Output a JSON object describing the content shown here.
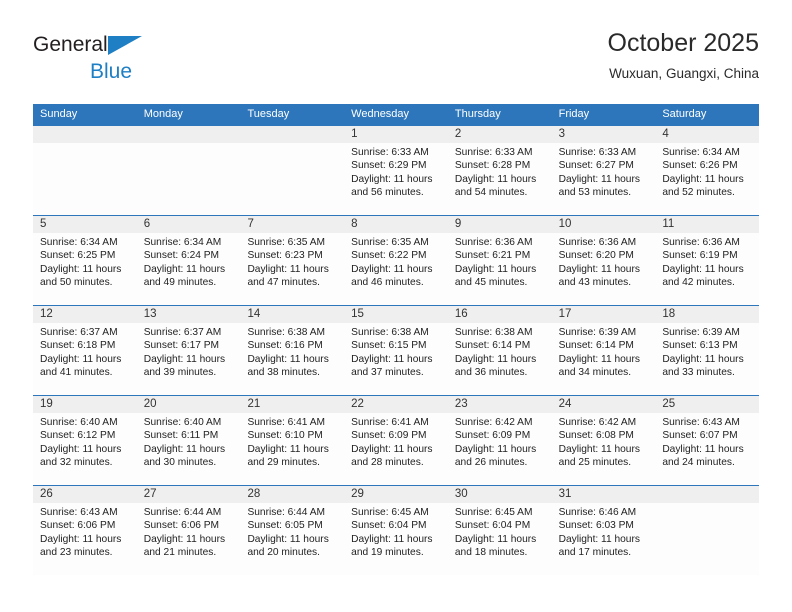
{
  "brand": {
    "name_top": "General",
    "name_bottom": "Blue",
    "triangle_color": "#1f7fc4",
    "top_text_color": "#231f20"
  },
  "header": {
    "title": "October 2025",
    "subtitle": "Wuxuan, Guangxi, China"
  },
  "theme": {
    "header_blue": "#2d76bb",
    "daynum_bar": "#efefef",
    "cell_bg": "#fdfdfd",
    "text": "#222222"
  },
  "weekdays": [
    "Sunday",
    "Monday",
    "Tuesday",
    "Wednesday",
    "Thursday",
    "Friday",
    "Saturday"
  ],
  "weeks": [
    [
      {
        "day": "",
        "sunrise": "",
        "sunset": "",
        "daylight1": "",
        "daylight2": ""
      },
      {
        "day": "",
        "sunrise": "",
        "sunset": "",
        "daylight1": "",
        "daylight2": ""
      },
      {
        "day": "",
        "sunrise": "",
        "sunset": "",
        "daylight1": "",
        "daylight2": ""
      },
      {
        "day": "1",
        "sunrise": "Sunrise: 6:33 AM",
        "sunset": "Sunset: 6:29 PM",
        "daylight1": "Daylight: 11 hours",
        "daylight2": "and 56 minutes."
      },
      {
        "day": "2",
        "sunrise": "Sunrise: 6:33 AM",
        "sunset": "Sunset: 6:28 PM",
        "daylight1": "Daylight: 11 hours",
        "daylight2": "and 54 minutes."
      },
      {
        "day": "3",
        "sunrise": "Sunrise: 6:33 AM",
        "sunset": "Sunset: 6:27 PM",
        "daylight1": "Daylight: 11 hours",
        "daylight2": "and 53 minutes."
      },
      {
        "day": "4",
        "sunrise": "Sunrise: 6:34 AM",
        "sunset": "Sunset: 6:26 PM",
        "daylight1": "Daylight: 11 hours",
        "daylight2": "and 52 minutes."
      }
    ],
    [
      {
        "day": "5",
        "sunrise": "Sunrise: 6:34 AM",
        "sunset": "Sunset: 6:25 PM",
        "daylight1": "Daylight: 11 hours",
        "daylight2": "and 50 minutes."
      },
      {
        "day": "6",
        "sunrise": "Sunrise: 6:34 AM",
        "sunset": "Sunset: 6:24 PM",
        "daylight1": "Daylight: 11 hours",
        "daylight2": "and 49 minutes."
      },
      {
        "day": "7",
        "sunrise": "Sunrise: 6:35 AM",
        "sunset": "Sunset: 6:23 PM",
        "daylight1": "Daylight: 11 hours",
        "daylight2": "and 47 minutes."
      },
      {
        "day": "8",
        "sunrise": "Sunrise: 6:35 AM",
        "sunset": "Sunset: 6:22 PM",
        "daylight1": "Daylight: 11 hours",
        "daylight2": "and 46 minutes."
      },
      {
        "day": "9",
        "sunrise": "Sunrise: 6:36 AM",
        "sunset": "Sunset: 6:21 PM",
        "daylight1": "Daylight: 11 hours",
        "daylight2": "and 45 minutes."
      },
      {
        "day": "10",
        "sunrise": "Sunrise: 6:36 AM",
        "sunset": "Sunset: 6:20 PM",
        "daylight1": "Daylight: 11 hours",
        "daylight2": "and 43 minutes."
      },
      {
        "day": "11",
        "sunrise": "Sunrise: 6:36 AM",
        "sunset": "Sunset: 6:19 PM",
        "daylight1": "Daylight: 11 hours",
        "daylight2": "and 42 minutes."
      }
    ],
    [
      {
        "day": "12",
        "sunrise": "Sunrise: 6:37 AM",
        "sunset": "Sunset: 6:18 PM",
        "daylight1": "Daylight: 11 hours",
        "daylight2": "and 41 minutes."
      },
      {
        "day": "13",
        "sunrise": "Sunrise: 6:37 AM",
        "sunset": "Sunset: 6:17 PM",
        "daylight1": "Daylight: 11 hours",
        "daylight2": "and 39 minutes."
      },
      {
        "day": "14",
        "sunrise": "Sunrise: 6:38 AM",
        "sunset": "Sunset: 6:16 PM",
        "daylight1": "Daylight: 11 hours",
        "daylight2": "and 38 minutes."
      },
      {
        "day": "15",
        "sunrise": "Sunrise: 6:38 AM",
        "sunset": "Sunset: 6:15 PM",
        "daylight1": "Daylight: 11 hours",
        "daylight2": "and 37 minutes."
      },
      {
        "day": "16",
        "sunrise": "Sunrise: 6:38 AM",
        "sunset": "Sunset: 6:14 PM",
        "daylight1": "Daylight: 11 hours",
        "daylight2": "and 36 minutes."
      },
      {
        "day": "17",
        "sunrise": "Sunrise: 6:39 AM",
        "sunset": "Sunset: 6:14 PM",
        "daylight1": "Daylight: 11 hours",
        "daylight2": "and 34 minutes."
      },
      {
        "day": "18",
        "sunrise": "Sunrise: 6:39 AM",
        "sunset": "Sunset: 6:13 PM",
        "daylight1": "Daylight: 11 hours",
        "daylight2": "and 33 minutes."
      }
    ],
    [
      {
        "day": "19",
        "sunrise": "Sunrise: 6:40 AM",
        "sunset": "Sunset: 6:12 PM",
        "daylight1": "Daylight: 11 hours",
        "daylight2": "and 32 minutes."
      },
      {
        "day": "20",
        "sunrise": "Sunrise: 6:40 AM",
        "sunset": "Sunset: 6:11 PM",
        "daylight1": "Daylight: 11 hours",
        "daylight2": "and 30 minutes."
      },
      {
        "day": "21",
        "sunrise": "Sunrise: 6:41 AM",
        "sunset": "Sunset: 6:10 PM",
        "daylight1": "Daylight: 11 hours",
        "daylight2": "and 29 minutes."
      },
      {
        "day": "22",
        "sunrise": "Sunrise: 6:41 AM",
        "sunset": "Sunset: 6:09 PM",
        "daylight1": "Daylight: 11 hours",
        "daylight2": "and 28 minutes."
      },
      {
        "day": "23",
        "sunrise": "Sunrise: 6:42 AM",
        "sunset": "Sunset: 6:09 PM",
        "daylight1": "Daylight: 11 hours",
        "daylight2": "and 26 minutes."
      },
      {
        "day": "24",
        "sunrise": "Sunrise: 6:42 AM",
        "sunset": "Sunset: 6:08 PM",
        "daylight1": "Daylight: 11 hours",
        "daylight2": "and 25 minutes."
      },
      {
        "day": "25",
        "sunrise": "Sunrise: 6:43 AM",
        "sunset": "Sunset: 6:07 PM",
        "daylight1": "Daylight: 11 hours",
        "daylight2": "and 24 minutes."
      }
    ],
    [
      {
        "day": "26",
        "sunrise": "Sunrise: 6:43 AM",
        "sunset": "Sunset: 6:06 PM",
        "daylight1": "Daylight: 11 hours",
        "daylight2": "and 23 minutes."
      },
      {
        "day": "27",
        "sunrise": "Sunrise: 6:44 AM",
        "sunset": "Sunset: 6:06 PM",
        "daylight1": "Daylight: 11 hours",
        "daylight2": "and 21 minutes."
      },
      {
        "day": "28",
        "sunrise": "Sunrise: 6:44 AM",
        "sunset": "Sunset: 6:05 PM",
        "daylight1": "Daylight: 11 hours",
        "daylight2": "and 20 minutes."
      },
      {
        "day": "29",
        "sunrise": "Sunrise: 6:45 AM",
        "sunset": "Sunset: 6:04 PM",
        "daylight1": "Daylight: 11 hours",
        "daylight2": "and 19 minutes."
      },
      {
        "day": "30",
        "sunrise": "Sunrise: 6:45 AM",
        "sunset": "Sunset: 6:04 PM",
        "daylight1": "Daylight: 11 hours",
        "daylight2": "and 18 minutes."
      },
      {
        "day": "31",
        "sunrise": "Sunrise: 6:46 AM",
        "sunset": "Sunset: 6:03 PM",
        "daylight1": "Daylight: 11 hours",
        "daylight2": "and 17 minutes."
      },
      {
        "day": "",
        "sunrise": "",
        "sunset": "",
        "daylight1": "",
        "daylight2": ""
      }
    ]
  ]
}
